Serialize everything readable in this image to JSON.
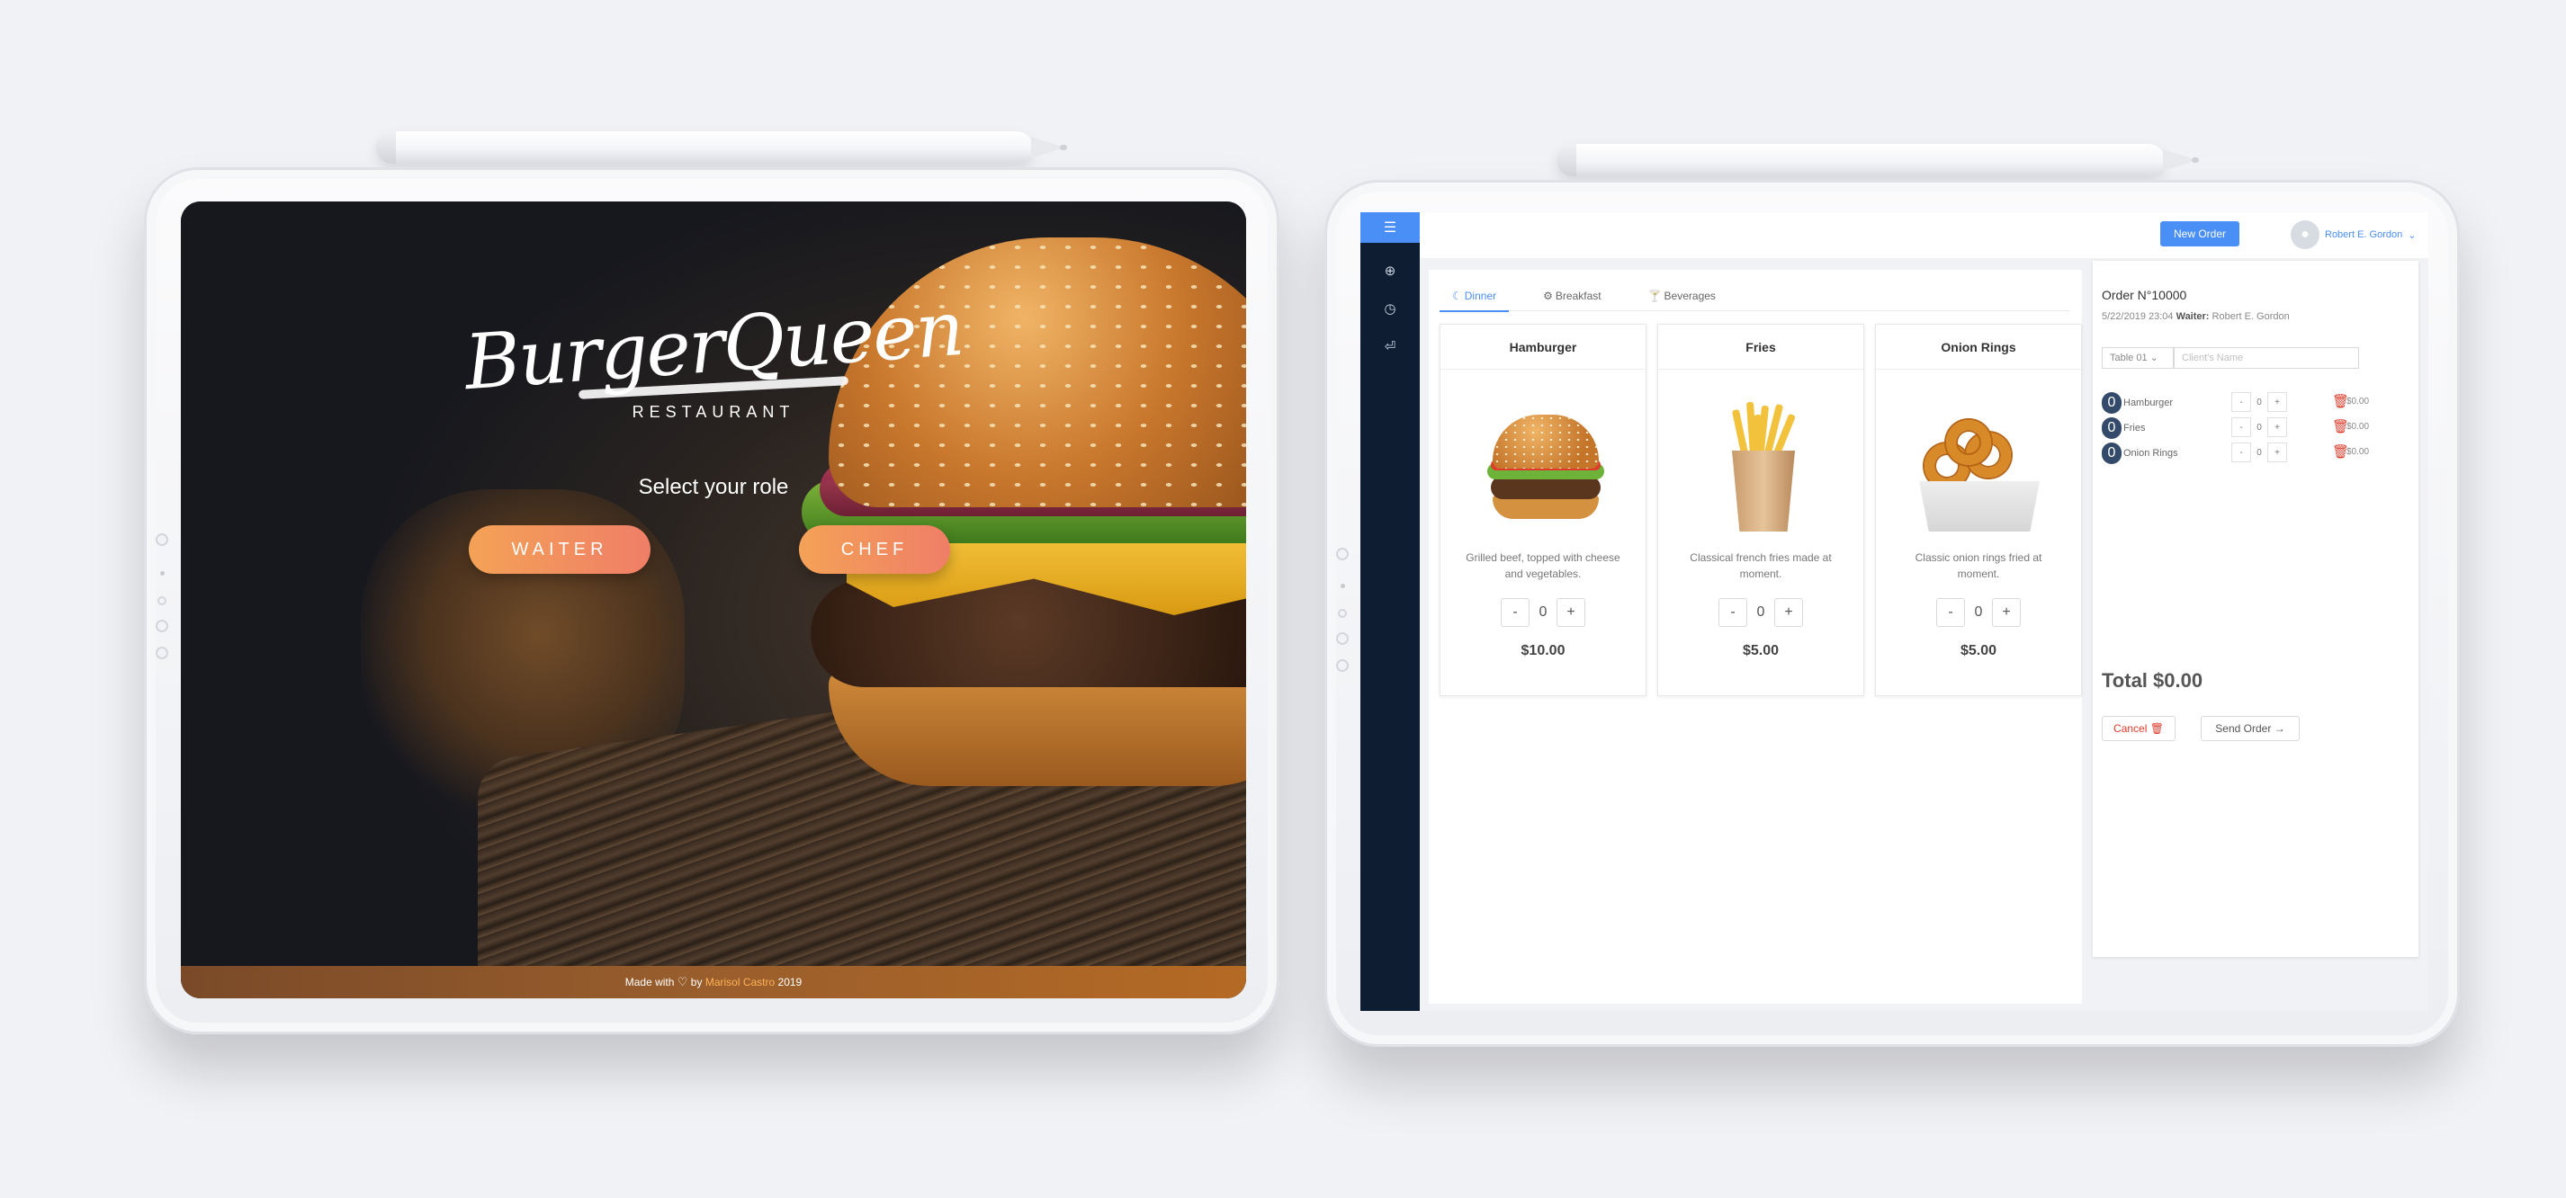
{
  "login": {
    "brand": "BurgerQueen",
    "brand_sub": "RESTAURANT",
    "role_title": "Select your role",
    "waiter_label": "WAITER",
    "chef_label": "CHEF",
    "footer_prefix": "Made with",
    "footer_by": "by",
    "footer_author": "Marisol Castro",
    "footer_year": "2019"
  },
  "app": {
    "new_order_label": "New Order",
    "user_name": "Robert E. Gordon",
    "rail_icons": [
      "menu-icon",
      "plus-circle-icon",
      "clock-icon",
      "logout-icon"
    ],
    "tabs": [
      {
        "label": "Dinner",
        "icon": "moon-icon",
        "active": true
      },
      {
        "label": "Breakfast",
        "icon": "gear-icon",
        "active": false
      },
      {
        "label": "Beverages",
        "icon": "cocktail-icon",
        "active": false
      }
    ],
    "products": [
      {
        "name": "Hamburger",
        "description": "Grilled beef, topped with cheese and vegetables.",
        "quantity": "0",
        "price": "$10.00"
      },
      {
        "name": "Fries",
        "description": "Classical french fries made at moment.",
        "quantity": "0",
        "price": "$5.00"
      },
      {
        "name": "Onion Rings",
        "description": "Classic onion rings fried at moment.",
        "quantity": "0",
        "price": "$5.00"
      }
    ],
    "order": {
      "title": "Order N°10000",
      "datetime": "5/22/2019 23:04",
      "waiter_label": "Waiter:",
      "waiter_name": "Robert E. Gordon",
      "table": "Table 01",
      "client_placeholder": "Client's Name",
      "items": [
        {
          "qty": "0",
          "name": "Hamburger",
          "count": "0",
          "price": "$0.00"
        },
        {
          "qty": "0",
          "name": "Fries",
          "count": "0",
          "price": "$0.00"
        },
        {
          "qty": "0",
          "name": "Onion Rings",
          "count": "0",
          "price": "$0.00"
        }
      ],
      "total": "Total $0.00",
      "cancel_label": "Cancel",
      "send_label": "Send Order"
    }
  },
  "colors": {
    "accent": "#4a8ff5",
    "rail": "#0f1d33",
    "role_button_start": "#f4a257",
    "role_button_end": "#ef7e67",
    "danger": "#e03b2a"
  }
}
